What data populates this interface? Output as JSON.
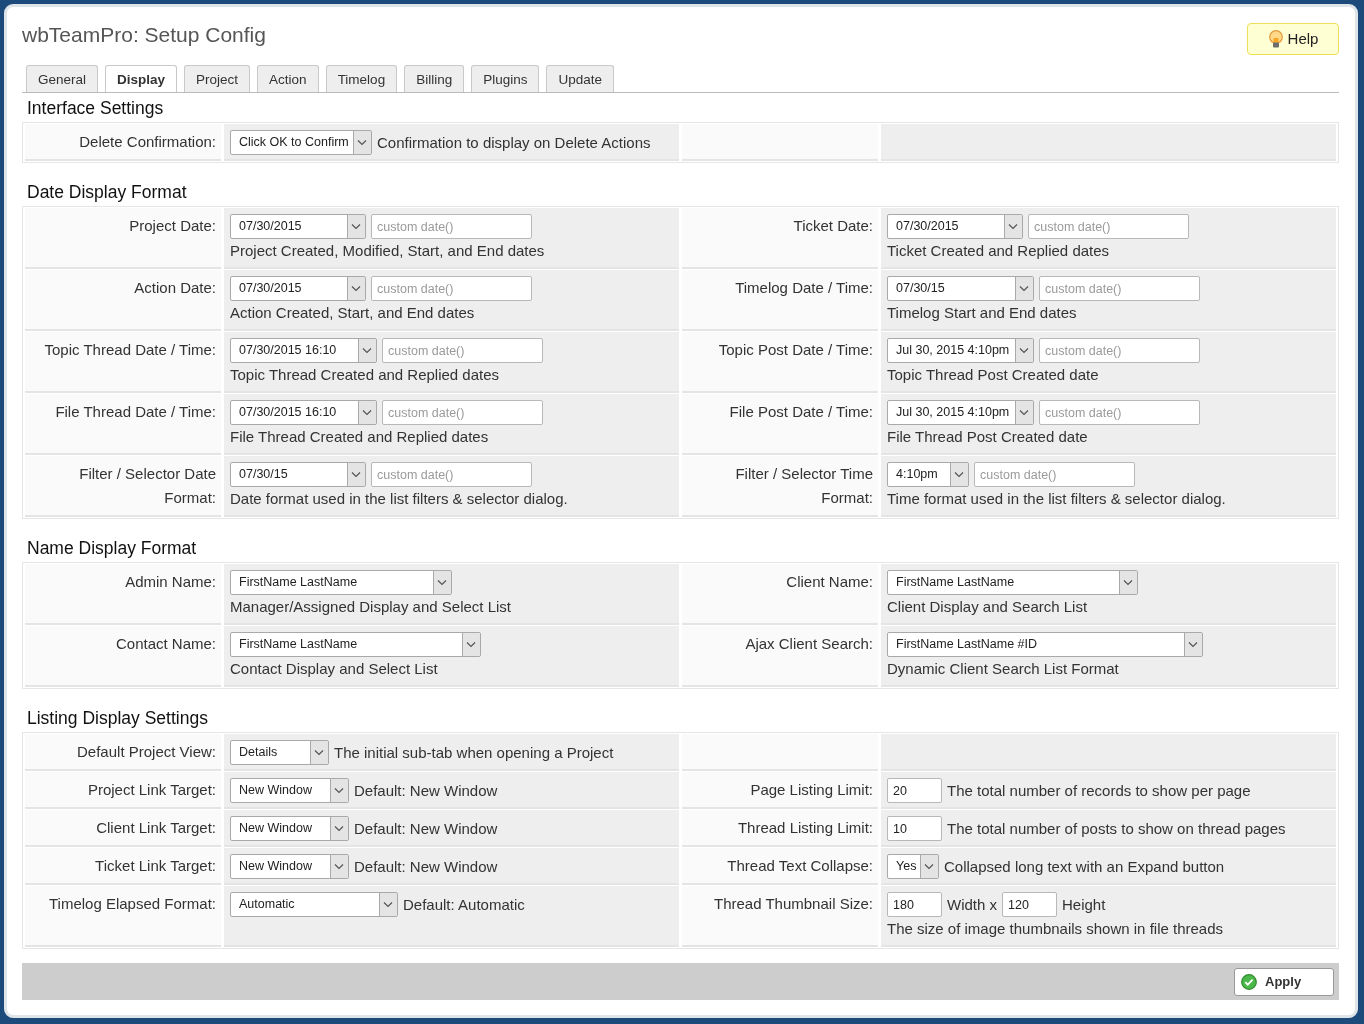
{
  "title": "wbTeamPro: Setup Config",
  "help_button": "Help",
  "tabs": [
    {
      "label": "General",
      "selected": false
    },
    {
      "label": "Display",
      "selected": true
    },
    {
      "label": "Project",
      "selected": false
    },
    {
      "label": "Action",
      "selected": false
    },
    {
      "label": "Timelog",
      "selected": false
    },
    {
      "label": "Billing",
      "selected": false
    },
    {
      "label": "Plugins",
      "selected": false
    },
    {
      "label": "Update",
      "selected": false
    }
  ],
  "sections": [
    {
      "heading": "Interface Settings",
      "rows": [
        {
          "left": {
            "label": "Delete Confirmation:",
            "controls": [
              {
                "kind": "select",
                "value": "Click OK to Confirm"
              },
              {
                "kind": "text",
                "text": "Confirmation to display on Delete Actions"
              }
            ]
          }
        }
      ]
    },
    {
      "heading": "Date Display Format",
      "rows": [
        {
          "left": {
            "label": "Project Date:",
            "controls": [
              {
                "kind": "select",
                "value": "07/30/2015"
              },
              {
                "kind": "input",
                "placeholder": "custom date()"
              }
            ],
            "note": "Project Created, Modified, Start, and End dates"
          },
          "right": {
            "label": "Ticket Date:",
            "controls": [
              {
                "kind": "select",
                "value": "07/30/2015"
              },
              {
                "kind": "input",
                "placeholder": "custom date()"
              }
            ],
            "note": "Ticket Created and Replied dates"
          }
        },
        {
          "left": {
            "label": "Action Date:",
            "controls": [
              {
                "kind": "select",
                "value": "07/30/2015"
              },
              {
                "kind": "input",
                "placeholder": "custom date()"
              }
            ],
            "note": "Action Created, Start, and End dates"
          },
          "right": {
            "label": "Timelog Date / Time:",
            "controls": [
              {
                "kind": "select",
                "value": "07/30/15"
              },
              {
                "kind": "input",
                "placeholder": "custom date()"
              }
            ],
            "note": "Timelog Start and End dates"
          }
        },
        {
          "left": {
            "label": "Topic Thread Date / Time:",
            "controls": [
              {
                "kind": "select",
                "value": "07/30/2015 16:10"
              },
              {
                "kind": "input",
                "placeholder": "custom date()"
              }
            ],
            "note": "Topic Thread Created and Replied dates"
          },
          "right": {
            "label": "Topic Post Date / Time:",
            "controls": [
              {
                "kind": "select",
                "value": "Jul 30, 2015 4:10pm"
              },
              {
                "kind": "input",
                "placeholder": "custom date()"
              }
            ],
            "note": "Topic Thread Post Created date"
          }
        },
        {
          "left": {
            "label": "File Thread Date / Time:",
            "controls": [
              {
                "kind": "select",
                "value": "07/30/2015 16:10"
              },
              {
                "kind": "input",
                "placeholder": "custom date()"
              }
            ],
            "note": "File Thread Created and Replied dates"
          },
          "right": {
            "label": "File Post Date / Time:",
            "controls": [
              {
                "kind": "select",
                "value": "Jul 30, 2015 4:10pm"
              },
              {
                "kind": "input",
                "placeholder": "custom date()"
              }
            ],
            "note": "File Thread Post Created date"
          }
        },
        {
          "left": {
            "label": "Filter / Selector Date Format:",
            "controls": [
              {
                "kind": "select",
                "value": "07/30/15"
              },
              {
                "kind": "input",
                "placeholder": "custom date()"
              }
            ],
            "note": "Date format used in the list filters & selector dialog."
          },
          "right": {
            "label": "Filter / Selector Time Format:",
            "controls": [
              {
                "kind": "select",
                "value": "4:10pm"
              },
              {
                "kind": "input",
                "placeholder": "custom date()"
              }
            ],
            "note": "Time format used in the list filters & selector dialog."
          }
        }
      ]
    },
    {
      "heading": "Name Display Format",
      "rows": [
        {
          "left": {
            "label": "Admin Name:",
            "controls": [
              {
                "kind": "select",
                "value": "FirstName LastName"
              }
            ],
            "note": "Manager/Assigned Display and Select List"
          },
          "right": {
            "label": "Client Name:",
            "controls": [
              {
                "kind": "select",
                "value": "FirstName LastName"
              }
            ],
            "note": "Client Display and Search List"
          }
        },
        {
          "left": {
            "label": "Contact Name:",
            "controls": [
              {
                "kind": "select",
                "value": "FirstName LastName"
              }
            ],
            "note": "Contact Display and Select List"
          },
          "right": {
            "label": "Ajax Client Search:",
            "controls": [
              {
                "kind": "select",
                "value": "FirstName LastName #ID"
              }
            ],
            "note": "Dynamic Client Search List Format"
          }
        }
      ]
    },
    {
      "heading": "Listing Display Settings",
      "rows": [
        {
          "left": {
            "label": "Default Project View:",
            "controls": [
              {
                "kind": "select",
                "value": "Details"
              },
              {
                "kind": "text",
                "text": "The initial sub-tab when opening a Project"
              }
            ]
          }
        },
        {
          "left": {
            "label": "Project Link Target:",
            "controls": [
              {
                "kind": "select",
                "value": "New Window"
              },
              {
                "kind": "text",
                "text": "Default: New Window"
              }
            ]
          },
          "right": {
            "label": "Page Listing Limit:",
            "controls": [
              {
                "kind": "input",
                "value": "20"
              },
              {
                "kind": "text",
                "text": "The total number of records to show per page"
              }
            ]
          }
        },
        {
          "left": {
            "label": "Client Link Target:",
            "controls": [
              {
                "kind": "select",
                "value": "New Window"
              },
              {
                "kind": "text",
                "text": "Default: New Window"
              }
            ]
          },
          "right": {
            "label": "Thread Listing Limit:",
            "controls": [
              {
                "kind": "input",
                "value": "10"
              },
              {
                "kind": "text",
                "text": "The total number of posts to show on thread pages"
              }
            ]
          }
        },
        {
          "left": {
            "label": "Ticket Link Target:",
            "controls": [
              {
                "kind": "select",
                "value": "New Window"
              },
              {
                "kind": "text",
                "text": "Default: New Window"
              }
            ]
          },
          "right": {
            "label": "Thread Text Collapse:",
            "controls": [
              {
                "kind": "select",
                "value": "Yes"
              },
              {
                "kind": "text",
                "text": "Collapsed long text with an Expand button"
              }
            ]
          }
        },
        {
          "left": {
            "label": "Timelog Elapsed Format:",
            "controls": [
              {
                "kind": "select",
                "value": "Automatic"
              },
              {
                "kind": "text",
                "text": "Default: Automatic"
              }
            ]
          },
          "right": {
            "label": "Thread Thumbnail Size:",
            "controls": [
              {
                "kind": "input",
                "value": "180"
              },
              {
                "kind": "text",
                "text": "Width x"
              },
              {
                "kind": "input",
                "value": "120"
              },
              {
                "kind": "text",
                "text": "Height"
              }
            ],
            "note": "The size of image thumbnails shown in file threads"
          }
        }
      ]
    }
  ],
  "apply_button": "Apply"
}
